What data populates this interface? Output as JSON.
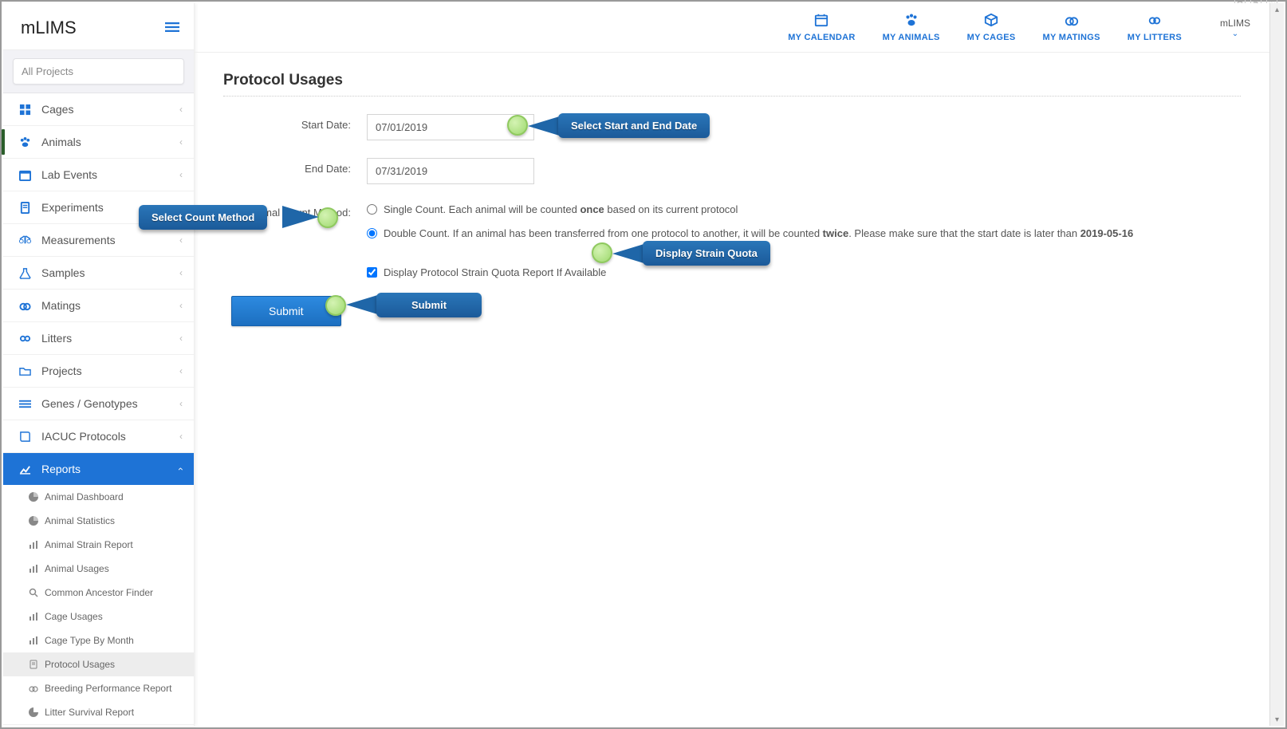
{
  "brand": "mLIMS",
  "project_selector": {
    "placeholder": "All Projects"
  },
  "sidebar": {
    "items": [
      {
        "label": "Cages",
        "icon": "grid"
      },
      {
        "label": "Animals",
        "icon": "paw"
      },
      {
        "label": "Lab Events",
        "icon": "calendar"
      },
      {
        "label": "Experiments",
        "icon": "flask-square"
      },
      {
        "label": "Measurements",
        "icon": "scale"
      },
      {
        "label": "Samples",
        "icon": "flask"
      },
      {
        "label": "Matings",
        "icon": "rings"
      },
      {
        "label": "Litters",
        "icon": "group"
      },
      {
        "label": "Projects",
        "icon": "folder"
      },
      {
        "label": "Genes / Genotypes",
        "icon": "lines"
      },
      {
        "label": "IACUC Protocols",
        "icon": "book"
      },
      {
        "label": "Reports",
        "icon": "chart"
      }
    ],
    "reports_sub": [
      {
        "label": "Animal Dashboard",
        "icon": "pie"
      },
      {
        "label": "Animal Statistics",
        "icon": "pie"
      },
      {
        "label": "Animal Strain Report",
        "icon": "bars"
      },
      {
        "label": "Animal Usages",
        "icon": "bars"
      },
      {
        "label": "Common Ancestor Finder",
        "icon": "search"
      },
      {
        "label": "Cage Usages",
        "icon": "bars"
      },
      {
        "label": "Cage Type By Month",
        "icon": "bars"
      },
      {
        "label": "Protocol Usages",
        "icon": "doc"
      },
      {
        "label": "Breeding Performance Report",
        "icon": "rings"
      },
      {
        "label": "Litter Survival Report",
        "icon": "pie"
      }
    ]
  },
  "topnav": {
    "items": [
      {
        "label": "MY CALENDAR",
        "icon": "calendar"
      },
      {
        "label": "MY ANIMALS",
        "icon": "paw"
      },
      {
        "label": "MY CAGES",
        "icon": "cube"
      },
      {
        "label": "MY MATINGS",
        "icon": "rings"
      },
      {
        "label": "MY LITTERS",
        "icon": "group"
      }
    ],
    "user_menu": "mLIMS"
  },
  "page": {
    "title": "Protocol Usages",
    "start_label": "Start Date:",
    "start_value": "07/01/2019",
    "end_label": "End Date:",
    "end_value": "07/31/2019",
    "count_label": "Animal Count Method:",
    "opt_single_pre": "Single Count. Each animal will be counted ",
    "opt_single_bold": "once",
    "opt_single_post": " based on its current protocol",
    "opt_double_pre": "Double Count. If an animal has been transferred from one protocol to another, it will be counted ",
    "opt_double_bold": "twice",
    "opt_double_post": ". Please make sure that the start date is later than ",
    "opt_double_date": "2019-05-16",
    "display_quota": "Display Protocol Strain Quota Report If Available",
    "submit": "Submit"
  },
  "annotations": {
    "dates": "Select Start and End Date",
    "count": "Select Count Method",
    "quota": "Display Strain Quota",
    "submit": "Submit"
  }
}
